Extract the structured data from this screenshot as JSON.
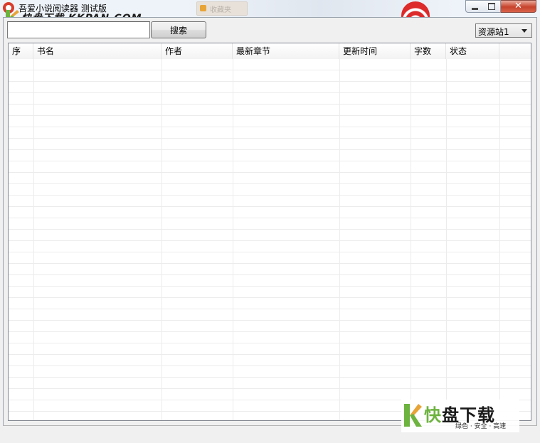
{
  "window": {
    "title": "吾爱小说阅读器 测试版",
    "background_tab_text": "收藏夹",
    "close_glyph": "✕"
  },
  "watermark_small": {
    "text": "快盘下载 KKPAN.COM"
  },
  "toolbar": {
    "search_value": "",
    "search_button_label": "搜索",
    "source_selected": "资源站1"
  },
  "list": {
    "columns": [
      "序",
      "书名",
      "作者",
      "最新章节",
      "更新时间",
      "字数",
      "状态"
    ],
    "rows": []
  },
  "watermark_big": {
    "main_green": "快",
    "main_dark": "盘下载",
    "tagline": "绿色 · 安全 · 高速"
  },
  "colors": {
    "accent_green": "#6db33f",
    "accent_orange": "#e7a437",
    "close_red": "#c7432c"
  }
}
